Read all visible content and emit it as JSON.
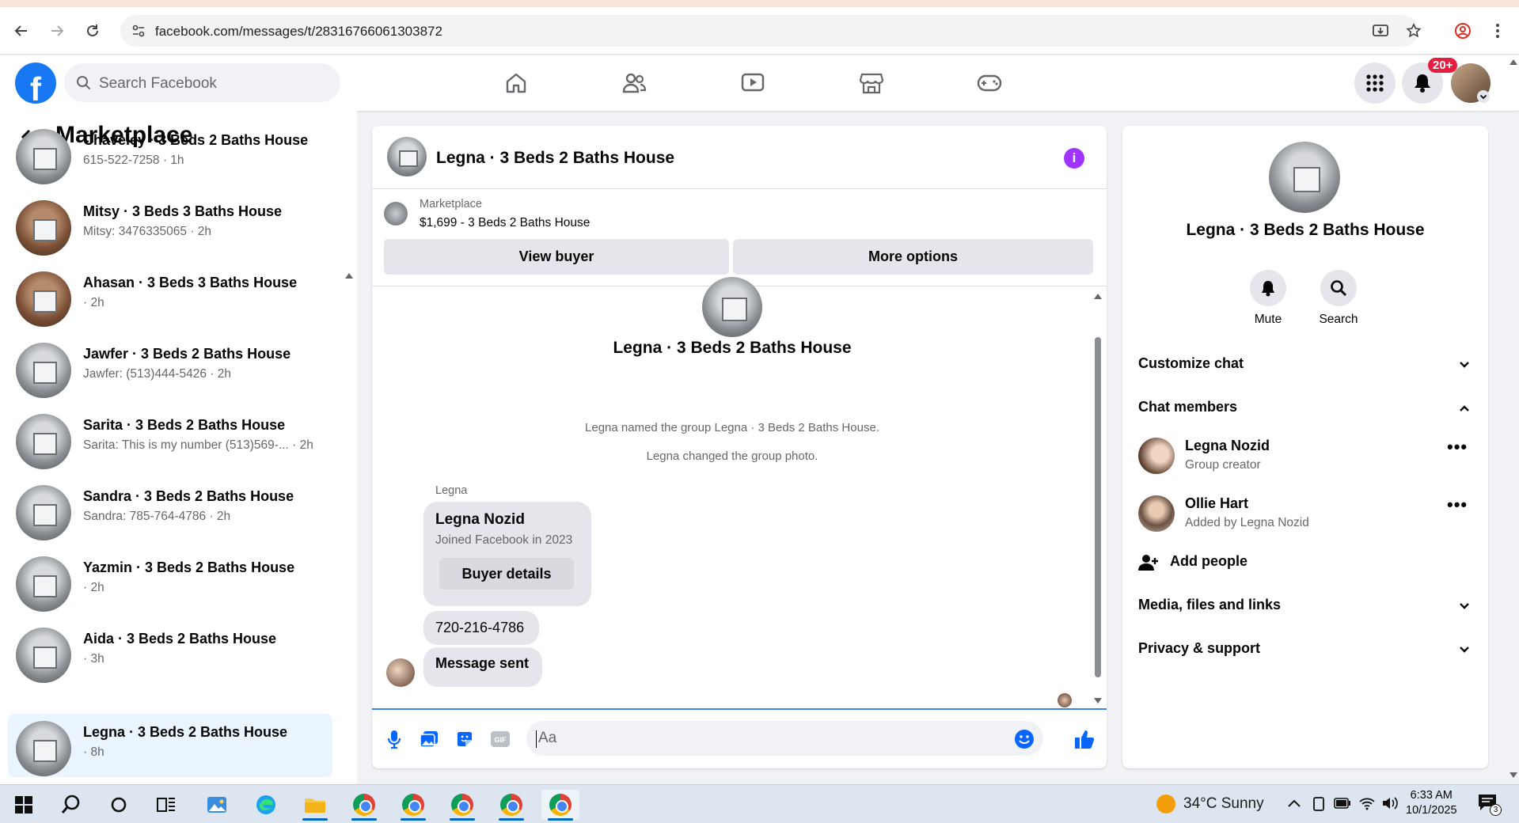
{
  "browser": {
    "url": "facebook.com/messages/t/28316766061303872"
  },
  "fb": {
    "search_placeholder": "Search Facebook",
    "notifications_badge": "20+",
    "brand_color": "#1877f2"
  },
  "sidebar": {
    "title": "Marketplace",
    "chats": [
      {
        "name": "Chaveley · 3 Beds 2 Baths House",
        "sub": "615-522-7258 · 1h",
        "thumb": "house-gray"
      },
      {
        "name": "Mitsy · 3 Beds 3 Baths House",
        "sub": "Mitsy: 3476335065 · 2h",
        "thumb": "house-brown"
      },
      {
        "name": "Ahasan · 3 Beds 3 Baths House",
        "sub": " · 2h",
        "thumb": "house-brown"
      },
      {
        "name": "Jawfer · 3 Beds 2 Baths House",
        "sub": "Jawfer: (513)444-5426 · 2h",
        "thumb": "house-gray"
      },
      {
        "name": "Sarita · 3 Beds 2 Baths House",
        "sub": "Sarita: This is my number (513)569-... · 2h",
        "thumb": "house-gray"
      },
      {
        "name": "Sandra · 3 Beds 2 Baths House",
        "sub": "Sandra: 785-764-4786 · 2h",
        "thumb": "house-gray"
      },
      {
        "name": "Yazmin · 3 Beds 2 Baths House",
        "sub": " · 2h",
        "thumb": "house-gray"
      },
      {
        "name": "Aida · 3 Beds 2 Baths House",
        "sub": " · 3h",
        "thumb": "house-gray"
      },
      {
        "name": "Legna · 3 Beds 2 Baths House",
        "sub": " · 8h",
        "thumb": "house-gray",
        "active": true
      }
    ]
  },
  "chat": {
    "title": "Legna · 3 Beds 2 Baths House",
    "marketplace_label": "Marketplace",
    "listing": "$1,699 - 3 Beds 2 Baths House",
    "view_buyer": "View buyer",
    "more_options": "More options",
    "conversation_title": "Legna · 3 Beds 2 Baths House",
    "system_messages": [
      "Legna named the group Legna · 3 Beds 2 Baths House.",
      "Legna changed the group photo."
    ],
    "sender": "Legna",
    "card": {
      "name": "Legna Nozid",
      "sub": "Joined Facebook in 2023",
      "button": "Buyer details"
    },
    "messages": [
      "720-216-4786",
      "Message sent"
    ],
    "input_placeholder": "Aa"
  },
  "info_panel": {
    "title": "Legna · 3 Beds 2 Baths House",
    "actions": [
      {
        "label": "Mute",
        "icon": "bell-icon"
      },
      {
        "label": "Search",
        "icon": "search-icon"
      }
    ],
    "sections": {
      "customize": "Customize chat",
      "members": "Chat members",
      "media": "Media, files and links",
      "privacy": "Privacy & support"
    },
    "members": [
      {
        "name": "Legna Nozid",
        "sub": "Group creator"
      },
      {
        "name": "Ollie Hart",
        "sub": "Added by Legna Nozid"
      }
    ],
    "add_people": "Add people"
  },
  "taskbar": {
    "weather": "34°C  Sunny",
    "time": "6:33 AM",
    "date": "10/1/2025",
    "notif_count": "3"
  }
}
